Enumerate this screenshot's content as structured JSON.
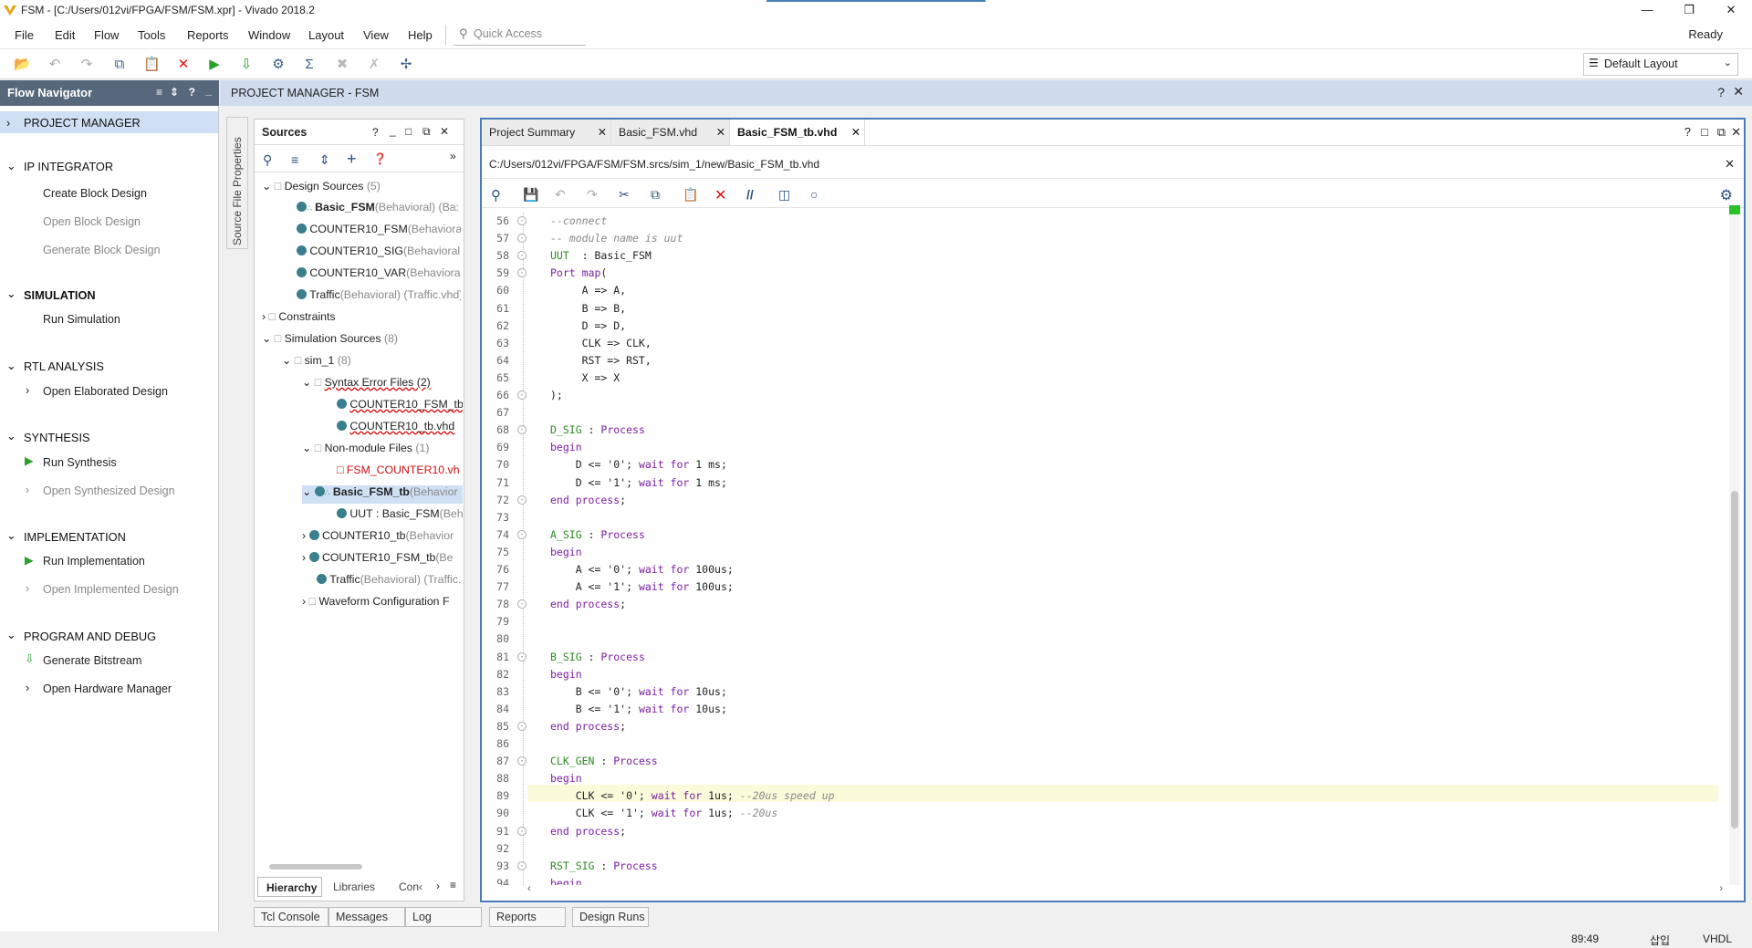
{
  "window": {
    "title": "FSM - [C:/Users/012vi/FPGA/FSM/FSM.xpr] - Vivado 2018.2",
    "status": "Ready"
  },
  "menu": [
    "File",
    "Edit",
    "Flow",
    "Tools",
    "Reports",
    "Window",
    "Layout",
    "View",
    "Help"
  ],
  "quick_access_placeholder": "Quick Access",
  "layout_select": "Default Layout",
  "flow_navigator": {
    "title": "Flow Navigator",
    "project_manager": "PROJECT MANAGER",
    "ip_integrator": "IP INTEGRATOR",
    "create_block_design": "Create Block Design",
    "open_block_design": "Open Block Design",
    "generate_block_design": "Generate Block Design",
    "simulation": "SIMULATION",
    "run_simulation": "Run Simulation",
    "rtl_analysis": "RTL ANALYSIS",
    "open_elaborated": "Open Elaborated Design",
    "synthesis": "SYNTHESIS",
    "run_synthesis": "Run Synthesis",
    "open_synthesized": "Open Synthesized Design",
    "implementation": "IMPLEMENTATION",
    "run_implementation": "Run Implementation",
    "open_implemented": "Open Implemented Design",
    "program_debug": "PROGRAM AND DEBUG",
    "generate_bitstream": "Generate Bitstream",
    "open_hw_manager": "Open Hardware Manager"
  },
  "pm_header": "PROJECT MANAGER - FSM",
  "source_file_properties": "Source File Properties",
  "sources": {
    "title": "Sources",
    "design_sources": "Design Sources",
    "design_sources_count": "(5)",
    "basic_fsm": "Basic_FSM",
    "basic_fsm_meta": "(Behavioral) (Ba:",
    "c10fsm": "COUNTER10_FSM",
    "c10fsm_meta": "(Behaviora",
    "c10sig": "COUNTER10_SIG",
    "c10sig_meta": "(Behavioral",
    "c10var": "COUNTER10_VAR",
    "c10var_meta": "(Behaviora",
    "traffic": "Traffic",
    "traffic_meta": "(Behavioral) (Traffic.vhd)",
    "constraints": "Constraints",
    "sim_sources": "Simulation Sources",
    "sim_sources_count": "(8)",
    "sim1": "sim_1",
    "sim1_count": "(8)",
    "syntax_err": "Syntax Error Files (2)",
    "c10fsm_tb": "COUNTER10_FSM_tb",
    "c10tb_vhd": "COUNTER10_tb.vhd",
    "nonmodule": "Non-module Files",
    "nonmodule_count": "(1)",
    "fsm_counter10": "FSM_COUNTER10.vh",
    "basic_fsm_tb": "Basic_FSM_tb",
    "basic_fsm_tb_meta": "(Behavior",
    "uut": "UUT : Basic_FSM",
    "uut_meta": "(Beh",
    "c10_tb": "COUNTER10_tb",
    "c10_tb_meta": "(Behavior",
    "c10_fsm_tb2": "COUNTER10_FSM_tb",
    "c10_fsm_tb2_meta": "(Be",
    "traffic2": "Traffic",
    "traffic2_meta": "(Behavioral) (Traffic.",
    "waveform": "Waveform Configuration F",
    "tabs": [
      "Hierarchy",
      "Libraries",
      "Con‹"
    ]
  },
  "editor": {
    "tabs": [
      "Project Summary",
      "Basic_FSM.vhd",
      "Basic_FSM_tb.vhd"
    ],
    "path": "C:/Users/012vi/FPGA/FSM/FSM.srcs/sim_1/new/Basic_FSM_tb.vhd"
  },
  "code": [
    {
      "n": "56",
      "t": [
        [
          "cm",
          "--connect"
        ]
      ]
    },
    {
      "n": "57",
      "t": [
        [
          "cm",
          "-- module name is uut"
        ]
      ]
    },
    {
      "n": "58",
      "t": [
        [
          "gn",
          "UUT"
        ],
        [
          "",
          "  : "
        ],
        [
          "",
          "Basic_FSM"
        ]
      ]
    },
    {
      "n": "59",
      "t": [
        [
          "kw",
          "Port map"
        ],
        [
          "",
          "("
        ]
      ]
    },
    {
      "n": "60",
      "t": [
        [
          "",
          "     A => A,"
        ]
      ]
    },
    {
      "n": "61",
      "t": [
        [
          "",
          "     B => B,"
        ]
      ]
    },
    {
      "n": "62",
      "t": [
        [
          "",
          "     D => D,"
        ]
      ]
    },
    {
      "n": "63",
      "t": [
        [
          "",
          "     CLK => CLK,"
        ]
      ]
    },
    {
      "n": "64",
      "t": [
        [
          "",
          "     RST => RST,"
        ]
      ]
    },
    {
      "n": "65",
      "t": [
        [
          "",
          "     X => X"
        ]
      ]
    },
    {
      "n": "66",
      "t": [
        [
          "",
          ");"
        ]
      ]
    },
    {
      "n": "67",
      "t": []
    },
    {
      "n": "68",
      "t": [
        [
          "gn",
          "D_SIG"
        ],
        [
          "",
          " : "
        ],
        [
          "kw",
          "Process"
        ]
      ]
    },
    {
      "n": "69",
      "t": [
        [
          "kw",
          "begin"
        ]
      ]
    },
    {
      "n": "70",
      "t": [
        [
          "",
          "    D <= '0'; "
        ],
        [
          "kw",
          "wait for"
        ],
        [
          "",
          " 1 ms;"
        ]
      ]
    },
    {
      "n": "71",
      "t": [
        [
          "",
          "    D <= '1'; "
        ],
        [
          "kw",
          "wait for"
        ],
        [
          "",
          " 1 ms;"
        ]
      ]
    },
    {
      "n": "72",
      "t": [
        [
          "kw",
          "end process"
        ],
        [
          "",
          ";"
        ]
      ]
    },
    {
      "n": "73",
      "t": []
    },
    {
      "n": "74",
      "t": [
        [
          "gn",
          "A_SIG"
        ],
        [
          "",
          " : "
        ],
        [
          "kw",
          "Process"
        ]
      ]
    },
    {
      "n": "75",
      "t": [
        [
          "kw",
          "begin"
        ]
      ]
    },
    {
      "n": "76",
      "t": [
        [
          "",
          "    A <= '0'; "
        ],
        [
          "kw",
          "wait for"
        ],
        [
          "",
          " 100us;"
        ]
      ]
    },
    {
      "n": "77",
      "t": [
        [
          "",
          "    A <= '1'; "
        ],
        [
          "kw",
          "wait for"
        ],
        [
          "",
          " 100us;"
        ]
      ]
    },
    {
      "n": "78",
      "t": [
        [
          "kw",
          "end process"
        ],
        [
          "",
          ";"
        ]
      ]
    },
    {
      "n": "79",
      "t": []
    },
    {
      "n": "80",
      "t": []
    },
    {
      "n": "81",
      "t": [
        [
          "gn",
          "B_SIG"
        ],
        [
          "",
          " : "
        ],
        [
          "kw",
          "Process"
        ]
      ]
    },
    {
      "n": "82",
      "t": [
        [
          "kw",
          "begin"
        ]
      ]
    },
    {
      "n": "83",
      "t": [
        [
          "",
          "    B <= '0'; "
        ],
        [
          "kw",
          "wait for"
        ],
        [
          "",
          " 10us;"
        ]
      ]
    },
    {
      "n": "84",
      "t": [
        [
          "",
          "    B <= '1'; "
        ],
        [
          "kw",
          "wait for"
        ],
        [
          "",
          " 10us;"
        ]
      ]
    },
    {
      "n": "85",
      "t": [
        [
          "kw",
          "end process"
        ],
        [
          "",
          ";"
        ]
      ]
    },
    {
      "n": "86",
      "t": []
    },
    {
      "n": "87",
      "t": [
        [
          "gn",
          "CLK_GEN"
        ],
        [
          "",
          " : "
        ],
        [
          "kw",
          "Process"
        ]
      ]
    },
    {
      "n": "88",
      "t": [
        [
          "kw",
          "begin"
        ]
      ]
    },
    {
      "n": "89",
      "t": [
        [
          "",
          "    CLK <= '0'; "
        ],
        [
          "kw",
          "wait for"
        ],
        [
          "",
          " 1us; "
        ],
        [
          "cm",
          "--20us speed up"
        ]
      ]
    },
    {
      "n": "90",
      "t": [
        [
          "",
          "    CLK <= '1'; "
        ],
        [
          "kw",
          "wait for"
        ],
        [
          "",
          " 1us; "
        ],
        [
          "cm",
          "--20us"
        ]
      ]
    },
    {
      "n": "91",
      "t": [
        [
          "kw",
          "end process"
        ],
        [
          "",
          ";"
        ]
      ]
    },
    {
      "n": "92",
      "t": []
    },
    {
      "n": "93",
      "t": [
        [
          "gn",
          "RST_SIG"
        ],
        [
          "",
          " : "
        ],
        [
          "kw",
          "Process"
        ]
      ]
    },
    {
      "n": "94",
      "t": [
        [
          "kw",
          "begin"
        ]
      ]
    }
  ],
  "bottom_tabs": [
    "Tcl Console",
    "Messages",
    "Log",
    "Reports",
    "Design Runs"
  ],
  "status": {
    "cursor": "89:49",
    "mode": "삽입",
    "lang": "VHDL"
  }
}
